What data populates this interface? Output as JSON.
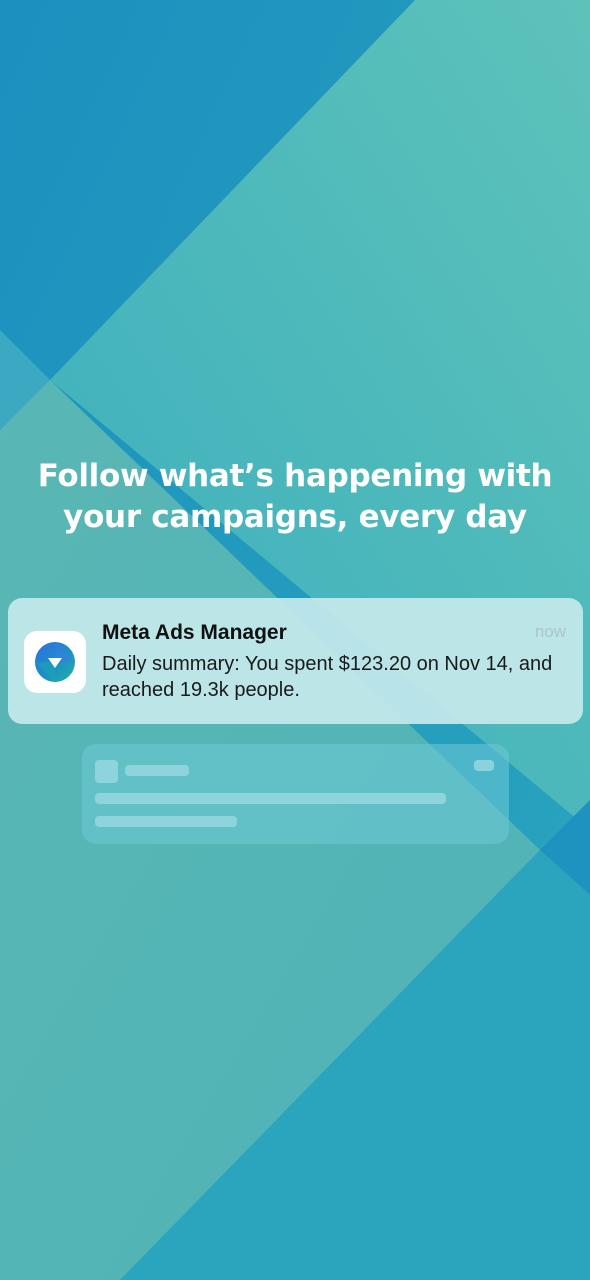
{
  "headline": {
    "line1": "Follow what’s happening with",
    "line2": "your campaigns, every day"
  },
  "notification": {
    "app_name": "Meta Ads Manager",
    "time": "now",
    "message": "Daily summary: You spent $123.20 on Nov 14, and reached 19.3k people.",
    "icon": "meta-ads-manager-app-icon"
  },
  "colors": {
    "background_top": "#1a98c2",
    "background_accent": "#5bbfb8",
    "notification_bg": "#c4e8eb",
    "text_primary": "#111111",
    "text_on_bg": "#ffffff"
  }
}
